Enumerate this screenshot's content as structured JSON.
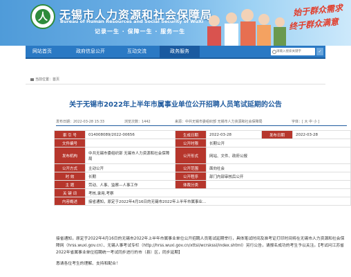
{
  "header": {
    "logo_char": "人",
    "title_cn": "无锡市人力资源和社会保障局",
    "title_en": "Bureau of Human Resources and Social Security of WuXi",
    "motto": "记录一生 · 保障一生 · 服务一生",
    "slogan1": "始于群众需求",
    "slogan2": "终于群众满意"
  },
  "nav": {
    "items": [
      "网站首页",
      "政府信息公开",
      "互动交流",
      "政务服务"
    ],
    "active_index": 3,
    "search_placeholder": "请输入搜索关键字",
    "search_button": "✓"
  },
  "breadcrumb": {
    "current": "当前位置：",
    "home": "首页"
  },
  "article": {
    "title": "关于无锡市2022年上半年市属事业单位公开招聘人员笔试延期的公告",
    "meta": {
      "date": "发布日期：2022-03-28 15:33",
      "views": "浏览次数：1442",
      "source": "来源：中共无锡市委组织部 无锡市人力资源和社会保障局",
      "font_size": "字体：[ 大 中 小 ]"
    },
    "info": [
      [
        {
          "l": "索 引 号"
        },
        {
          "v": "014008089/2022-00656"
        },
        {
          "l": "主题分类"
        },
        {
          "v": ""
        }
      ],
      [
        {
          "l": "文件编号"
        },
        {
          "v": ""
        },
        {
          "l": "公开时限"
        },
        {
          "v": "长期公开"
        }
      ],
      [
        {
          "l": "发布机构"
        },
        {
          "v": "中共无锡市委组织部 无锡市人力资源和社会保障局"
        },
        {
          "l": "公开形式"
        },
        {
          "v": "网站、文件、政府公报"
        }
      ],
      [
        {
          "l": "公开方式"
        },
        {
          "v": "主动公开"
        },
        {
          "l": "公开范围"
        },
        {
          "v": "面向社会"
        }
      ],
      [
        {
          "l": "时 效"
        },
        {
          "v": "长期"
        },
        {
          "l": "公开程序"
        },
        {
          "v": "部门内部审核后公开"
        }
      ],
      [
        {
          "l": "主 题"
        },
        {
          "v": "劳动、人事、监察—人事工作"
        },
        {
          "l": "体裁分类"
        },
        {
          "v": ""
        }
      ],
      [
        {
          "l": "关 键 词"
        },
        {
          "v": "考核,录用,考察"
        },
        {
          "l": ""
        },
        {
          "v": ""
        }
      ]
    ],
    "info_dates": [
      "2022-03-28",
      "2022-03-28",
      "2022-03-28"
    ],
    "summary_label": "内容概述",
    "summary": "接省通知，原定于2022年4月16日的无锡市2022年上半年市属事业...",
    "body_p1": "接省通知，原定于2022年4月16日的无锡市2022年上半年市属事业单位公开招聘人员笔试延期举行，具体笔试时间及准考证打印时间将在无锡市人力资源和社会保障网（hrss.wuxi.gov.cn）、无锡人事考试专栏（http://hrss.wuxi.gov.cn/xttsl/wcrskssl/index.shtml）另行公告，请报名成功的考生予以关注。【考试问江苏省2022年省属事业单位招聘统一考试同步进行的市（县）区，同步延期】",
    "body_p2": "恳请各位考生的理解、支持和配合！"
  }
}
